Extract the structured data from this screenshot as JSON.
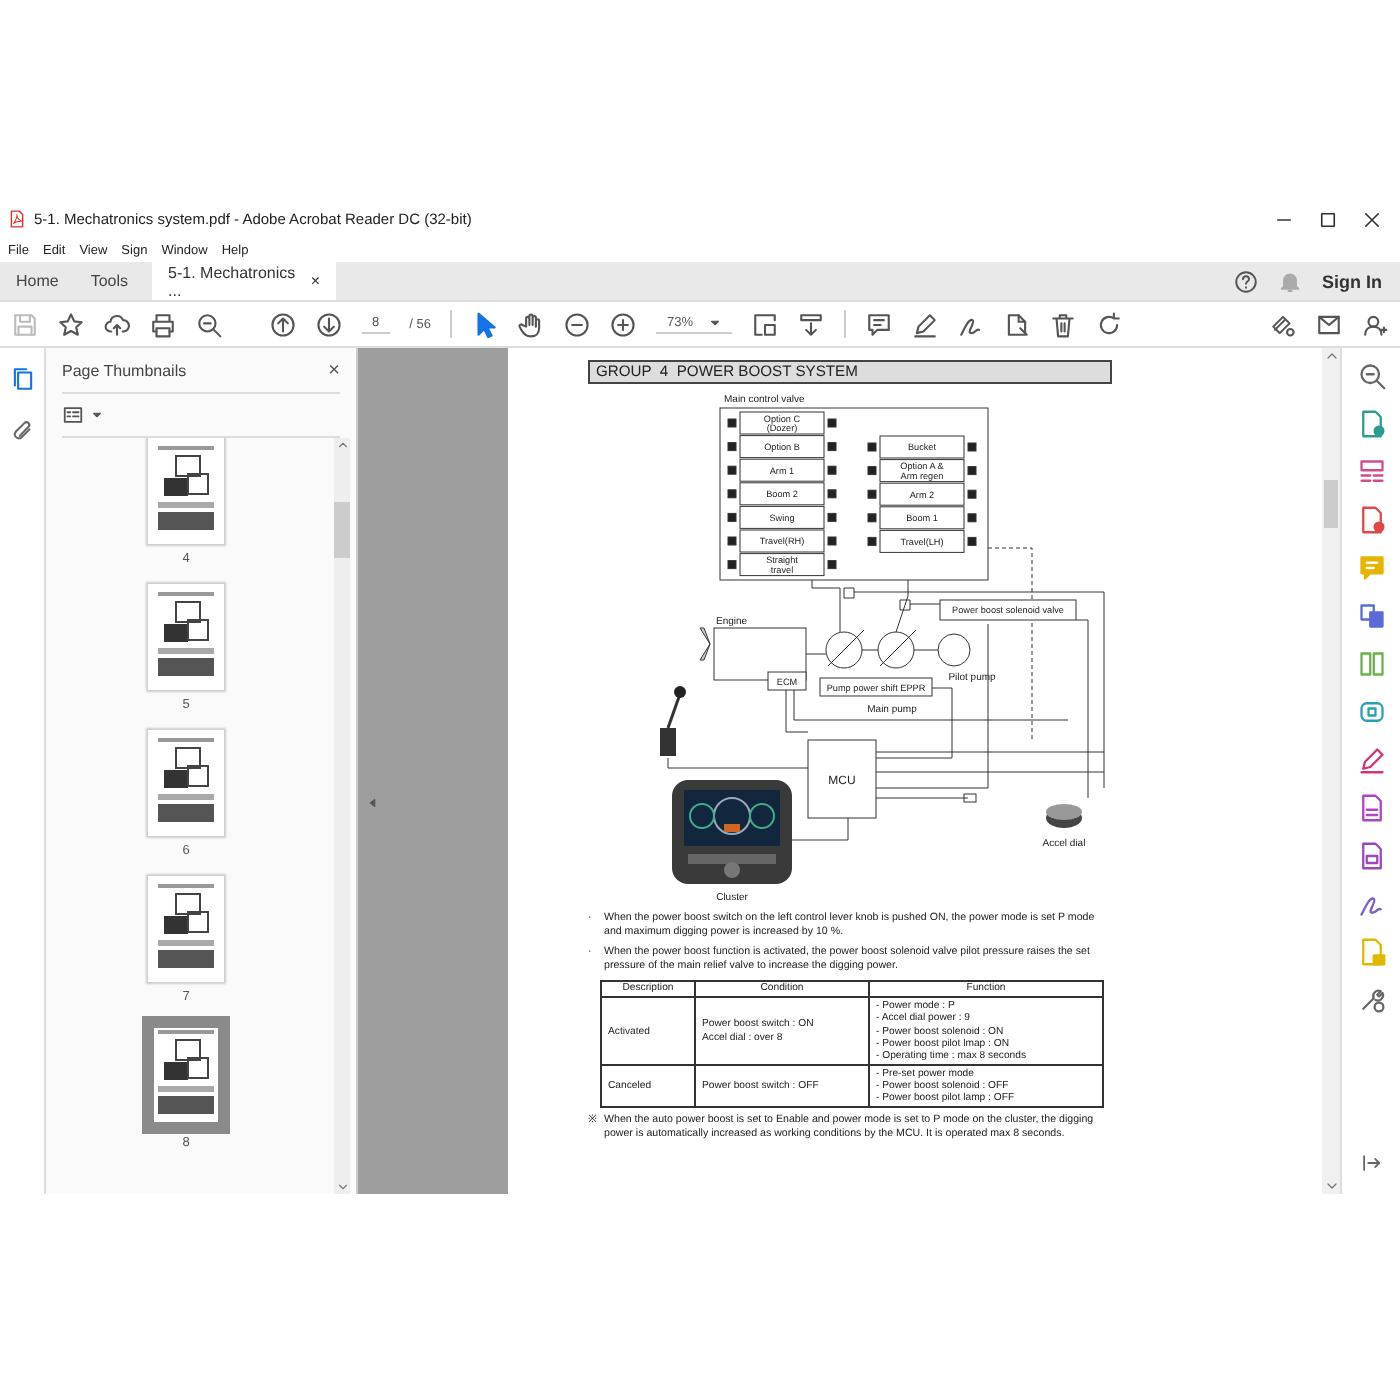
{
  "window": {
    "title": "5-1. Mechatronics system.pdf - Adobe Acrobat Reader DC (32-bit)"
  },
  "menu": [
    "File",
    "Edit",
    "View",
    "Sign",
    "Window",
    "Help"
  ],
  "tabs": [
    {
      "label": "Home",
      "selected": false
    },
    {
      "label": "Tools",
      "selected": false
    },
    {
      "label": "5-1. Mechatronics ...",
      "selected": true,
      "close": "×"
    }
  ],
  "sign_in": "Sign In",
  "toolbar": {
    "page": "8",
    "page_total": "/ 56",
    "zoom": "73%",
    "tools": [
      {
        "kind": "select",
        "selected": true
      },
      {
        "kind": "hand",
        "selected": false
      }
    ]
  },
  "left_rail": [
    {
      "kind": "thumbnails",
      "selected": true
    },
    {
      "kind": "attachments",
      "selected": false
    }
  ],
  "thumbnails_panel": {
    "title": "Page Thumbnails",
    "close": "×",
    "pages": [
      {
        "label": "4",
        "selected": false
      },
      {
        "label": "5",
        "selected": false
      },
      {
        "label": "6",
        "selected": false
      },
      {
        "label": "7",
        "selected": false
      },
      {
        "label": "8",
        "selected": true
      }
    ]
  },
  "document": {
    "heading": "GROUP  4  POWER BOOST SYSTEM",
    "diagram": {
      "title": "Main control valve",
      "left_spools": [
        [
          "Option C",
          "(Dozer)"
        ],
        [
          "Option B"
        ],
        [
          "Arm 1"
        ],
        [
          "Boom 2"
        ],
        [
          "Swing"
        ],
        [
          "Travel(RH)"
        ],
        [
          "Straight",
          "travel"
        ]
      ],
      "right_spools": [
        [
          "Bucket"
        ],
        [
          "Option A &",
          "Arm regen"
        ],
        [
          "Arm 2"
        ],
        [
          "Boom 1"
        ],
        [
          "Travel(LH)"
        ]
      ],
      "components": [
        "Engine",
        "ECM",
        "Main pump",
        "Pilot pump",
        "MCU",
        "Cluster",
        "Accel dial",
        "Power boost solenoid valve",
        "Pump power shift EPPR"
      ]
    },
    "paragraphs": [
      {
        "marker": "·",
        "text": "When the power boost switch on the left control lever knob is pushed ON, the power mode is set P mode and maximum digging power is increased by 10 %."
      },
      {
        "marker": "·",
        "text": "When the power boost function is activated, the power boost solenoid valve pilot pressure raises the set pressure of the main relief valve to increase the digging power."
      }
    ],
    "table": {
      "columns": [
        "Description",
        "Condition",
        "Function"
      ],
      "rows": [
        {
          "cells": [
            [
              "Activated"
            ],
            [
              "Power boost switch : ON",
              "Accel dial : over 8"
            ],
            [
              "- Power mode : P",
              "- Accel dial power : 9",
              "- Power boost solenoid : ON",
              "- Power boost pilot lmap : ON",
              "- Operating time : max 8 seconds"
            ]
          ]
        },
        {
          "cells": [
            [
              "Canceled"
            ],
            [
              "Power boost switch : OFF"
            ],
            [
              "- Pre-set power mode",
              "- Power boost solenoid : OFF",
              "- Power boost pilot lamp : OFF"
            ]
          ]
        }
      ]
    },
    "note": {
      "marker": "※",
      "text": "When the auto power boost is set to Enable and power mode is set to P mode on the cluster, the digging power is automatically increased as working conditions by the MCU. It is operated max 8 seconds."
    }
  }
}
